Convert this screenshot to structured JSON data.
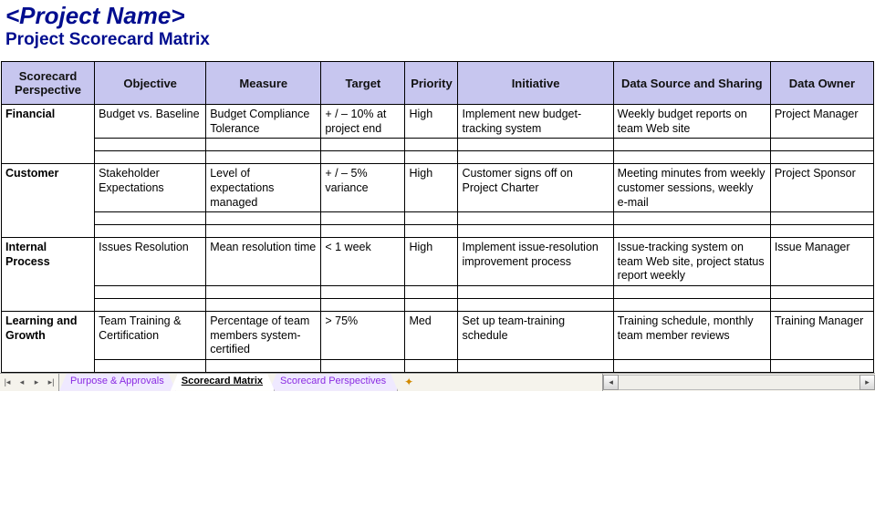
{
  "header": {
    "title": "<Project Name>",
    "subtitle": "Project Scorecard Matrix"
  },
  "columns": [
    "Scorecard Perspective",
    "Objective",
    "Measure",
    "Target",
    "Priority",
    "Initiative",
    "Data Source and Sharing",
    "Data Owner"
  ],
  "groups": [
    {
      "perspective": "Financial",
      "objective": "Budget vs. Baseline",
      "measure": "Budget Compliance Tolerance",
      "target": "+ / – 10% at project end",
      "priority": "High",
      "initiative": "Implement new budget-tracking system",
      "data_source": "Weekly budget reports on team Web site",
      "data_owner": "Project Manager"
    },
    {
      "perspective": "Customer",
      "objective": "Stakeholder Expectations",
      "measure": "Level of expectations managed",
      "target": "+ / – 5% variance",
      "priority": "High",
      "initiative": "Customer signs off on Project Charter",
      "data_source": "Meeting minutes from weekly customer sessions, weekly e-mail",
      "data_owner": "Project Sponsor"
    },
    {
      "perspective": "Internal Process",
      "objective": "Issues Resolution",
      "measure": "Mean resolution time",
      "target": "< 1 week",
      "priority": "High",
      "initiative": "Implement issue-resolution improvement process",
      "data_source": "Issue-tracking system on team Web site, project status report weekly",
      "data_owner": "Issue Manager"
    },
    {
      "perspective": "Learning and Growth",
      "objective": "Team Training & Certification",
      "measure": "Percentage of team members system-certified",
      "target": "> 75%",
      "priority": "Med",
      "initiative": "Set up team-training schedule",
      "data_source": "Training schedule, monthly team member reviews",
      "data_owner": "Training Manager"
    }
  ],
  "tabs": [
    {
      "label": "Purpose & Approvals",
      "active": false
    },
    {
      "label": "Scorecard Matrix",
      "active": true
    },
    {
      "label": "Scorecard Perspectives",
      "active": false
    }
  ]
}
